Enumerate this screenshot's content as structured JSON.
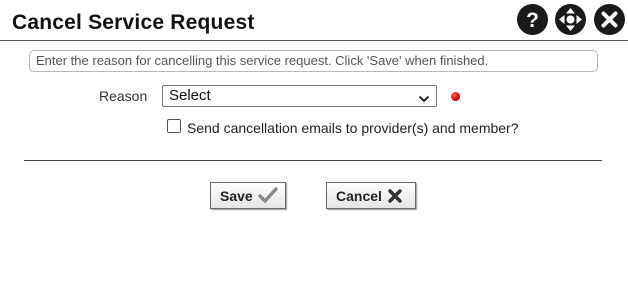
{
  "dialog": {
    "title": "Cancel Service Request",
    "icons": [
      "help-icon",
      "move-icon",
      "close-icon"
    ]
  },
  "hint": {
    "text": "Enter the reason for cancelling this service request. Click 'Save' when finished."
  },
  "form": {
    "reason_label": "Reason",
    "reason_value": "Select",
    "required_color": "#e00000",
    "checkbox_label": "Send cancellation emails to provider(s) and member?",
    "checkbox_checked": false
  },
  "buttons": {
    "save_label": "Save",
    "save_icon": "checkmark-icon",
    "cancel_label": "Cancel",
    "cancel_icon": "x-icon"
  }
}
